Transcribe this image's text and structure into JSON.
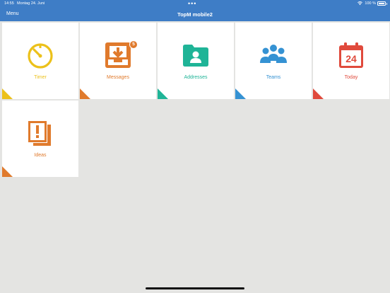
{
  "status": {
    "time": "14:55",
    "date": "Montag 24. Juni",
    "dots": "•••",
    "battery": "100 %"
  },
  "nav": {
    "menu": "Menu",
    "title": "TopM mobile2"
  },
  "tiles": [
    {
      "label": "Timer",
      "icon": "timer-icon",
      "color": "#ecc11a"
    },
    {
      "label": "Messages",
      "icon": "inbox-icon",
      "color": "#e07a2c",
      "badge": "5"
    },
    {
      "label": "Addresses",
      "icon": "folder-user-icon",
      "color": "#1fb497"
    },
    {
      "label": "Teams",
      "icon": "team-icon",
      "color": "#3592d3"
    },
    {
      "label": "Today",
      "icon": "calendar-icon",
      "color": "#e04a3c",
      "day": "24"
    },
    {
      "label": "Ideas",
      "icon": "ideas-icon",
      "color": "#e07a2c"
    }
  ]
}
